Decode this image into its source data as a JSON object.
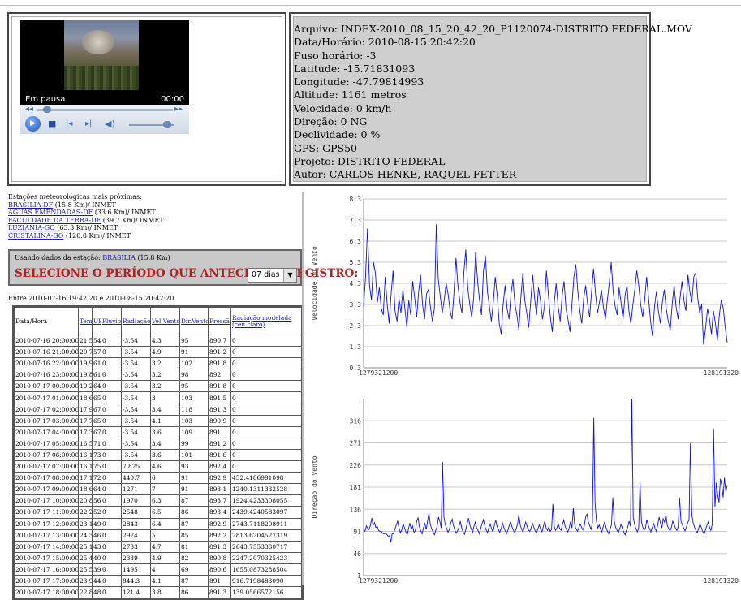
{
  "player": {
    "status": "Em pausa",
    "time": "00:00"
  },
  "info": {
    "lines": [
      "Arquivo: INDEX-2010_08_15_20_42_20_P1120074-DISTRITO FEDERAL.MOV",
      "Data/Horário: 2010-08-15 20:42:20",
      "Fuso horário: -3",
      "Latitude: -15.71831093",
      "Longitude: -47.79814993",
      "Altitude: 1161 metros",
      "Velocidade: 0 km/h",
      "Direção: 0 NG",
      "Declividade: 0 %",
      "GPS: GPS50",
      "Projeto: DISTRITO FEDERAL",
      "Autor: CARLOS HENKE, RAQUEL FETTER"
    ]
  },
  "stations": {
    "title": "Estações meteorológicas mais próximas:",
    "items": [
      {
        "name": "BRASILIA-DF",
        "detail": " (15.8 Km)/ INMET"
      },
      {
        "name": "AGUAS EMENDADAS-DF",
        "detail": " (33.6 Km)/ INMET"
      },
      {
        "name": "FACULDADE DA TERRA-DF",
        "detail": " (39.7 Km)/ INMET"
      },
      {
        "name": "LUZIÂNIA-GO",
        "detail": " (63.3 Km)/ INMET"
      },
      {
        "name": "CRISTALINA-GO",
        "detail": " (120.8 Km)/ INMET"
      }
    ]
  },
  "period": {
    "using_prefix": "Usando dados da estação: ",
    "using_station": "BRASILIA",
    "using_suffix": " (15.8 Km)",
    "select_label": "SELECIONE O PERÍODO QUE ANTECEDE O REGISTRO:",
    "selected": "07 dias"
  },
  "range_text": "Entre 2010-07-16 19:42:20 e 2010-08-15 20:42:20",
  "table": {
    "headers": [
      {
        "text": "Data/Hora",
        "link": false
      },
      {
        "text": "Temp",
        "link": true
      },
      {
        "text": "UR",
        "link": true
      },
      {
        "text": "Pluvio",
        "link": true
      },
      {
        "text": "Radiação",
        "link": true
      },
      {
        "text": "Vel.Vento",
        "link": true
      },
      {
        "text": "Dir.Vento",
        "link": true
      },
      {
        "text": "Pressão",
        "link": true
      },
      {
        "text": "Radiação modelada (céu claro)",
        "link": true
      }
    ],
    "rows": [
      [
        "2010-07-16 20:00:00",
        "21.5",
        "54",
        "0",
        "-3.54",
        "4.3",
        "95",
        "890.7",
        "0"
      ],
      [
        "2010-07-16 21:00:00",
        "20.7",
        "57",
        "0",
        "-3.54",
        "4.9",
        "91",
        "891.2",
        "0"
      ],
      [
        "2010-07-16 22:00:00",
        "19.9",
        "61",
        "0",
        "-3.54",
        "3.2",
        "102",
        "891.8",
        "0"
      ],
      [
        "2010-07-16 23:00:00",
        "19.8",
        "61",
        "0",
        "-3.54",
        "3.2",
        "98",
        "892",
        "0"
      ],
      [
        "2010-07-17 00:00:00",
        "19.2",
        "64",
        "0",
        "-3.54",
        "3.2",
        "95",
        "891.8",
        "0"
      ],
      [
        "2010-07-17 01:00:00",
        "18.6",
        "65",
        "0",
        "-3.54",
        "3",
        "103",
        "891.5",
        "0"
      ],
      [
        "2010-07-17 02:00:00",
        "17.9",
        "67",
        "0",
        "-3.54",
        "3.4",
        "118",
        "891.3",
        "0"
      ],
      [
        "2010-07-17 03:00:00",
        "17.7",
        "65",
        "0",
        "-3.54",
        "4.1",
        "103",
        "890.9",
        "0"
      ],
      [
        "2010-07-17 04:00:00",
        "17.3",
        "67",
        "0",
        "-3.54",
        "3.6",
        "109",
        "891",
        "0"
      ],
      [
        "2010-07-17 05:00:00",
        "16.5",
        "71",
        "0",
        "-3.54",
        "3.4",
        "99",
        "891.2",
        "0"
      ],
      [
        "2010-07-17 06:00:00",
        "16.1",
        "73",
        "0",
        "-3.54",
        "3.6",
        "101",
        "891.6",
        "0"
      ],
      [
        "2010-07-17 07:00:00",
        "16.1",
        "75",
        "0",
        "7.825",
        "4.6",
        "93",
        "892.4",
        "0"
      ],
      [
        "2010-07-17 08:00:00",
        "17.1",
        "72",
        "0",
        "440.7",
        "6",
        "91",
        "892.9",
        "452.4186991098"
      ],
      [
        "2010-07-17 09:00:00",
        "18.6",
        "64",
        "0",
        "1271",
        "7",
        "91",
        "893.1",
        "1240.1311332528"
      ],
      [
        "2010-07-17 10:00:00",
        "20.8",
        "56",
        "0",
        "1970",
        "6.3",
        "87",
        "893.7",
        "1924.4233308055"
      ],
      [
        "2010-07-17 11:00:00",
        "22.2",
        "52",
        "0",
        "2548",
        "6.5",
        "86",
        "893.4",
        "2439.4240583097"
      ],
      [
        "2010-07-17 12:00:00",
        "23.1",
        "49",
        "0",
        "2843",
        "6.4",
        "87",
        "892.9",
        "2743.7118208911"
      ],
      [
        "2010-07-17 13:00:00",
        "24.3",
        "46",
        "0",
        "2974",
        "5",
        "85",
        "892.2",
        "2813.6204527319"
      ],
      [
        "2010-07-17 14:00:00",
        "25.1",
        "43",
        "0",
        "2733",
        "4.7",
        "81",
        "891.3",
        "2643.7553380717"
      ],
      [
        "2010-07-17 15:00:00",
        "25.4",
        "40",
        "0",
        "2339",
        "4.9",
        "82",
        "890.8",
        "2247.2070325423"
      ],
      [
        "2010-07-17 16:00:00",
        "25.5",
        "39",
        "0",
        "1495",
        "4",
        "69",
        "890.6",
        "1655.0873288504"
      ],
      [
        "2010-07-17 17:00:00",
        "23.9",
        "44",
        "0",
        "844.3",
        "4.1",
        "87",
        "891",
        "916.7198483090"
      ],
      [
        "2010-07-17 18:00:00",
        "22.8",
        "48",
        "0",
        "121.4",
        "3.8",
        "86",
        "891.3",
        "139.0566572156"
      ]
    ]
  },
  "chart_data": [
    {
      "type": "line",
      "ylabel": "Velocidade do Vento",
      "xlim": [
        1279321200,
        1281913200
      ],
      "xtick_labels": [
        "1279321200",
        "128191320"
      ],
      "ylim": [
        0.3,
        8.3
      ],
      "yticks": [
        0.3,
        1.3,
        2.3,
        3.3,
        4.3,
        5.3,
        6.3,
        7.3,
        8.3
      ],
      "grid": true,
      "color": "#1010e0",
      "series": [
        {
          "values": [
            3.2,
            4.6,
            6.9,
            4.2,
            3.5,
            5.3,
            4.8,
            3.4,
            4.1,
            3.1,
            2.8,
            4.6,
            3.3,
            2.4,
            3.8,
            4.9,
            3.0,
            2.5,
            3.6,
            2.9,
            4.0,
            3.1,
            2.2,
            3.5,
            2.8,
            4.4,
            3.6,
            2.7,
            3.9,
            4.7,
            3.3,
            2.6,
            3.8,
            4.0,
            3.2,
            2.5,
            3.1,
            7.1,
            4.5,
            3.7,
            2.9,
            3.5,
            4.3,
            3.8,
            3.0,
            2.6,
            3.9,
            5.5,
            4.2,
            3.4,
            2.9,
            4.8,
            5.9,
            4.1,
            3.3,
            2.7,
            3.6,
            5.8,
            4.4,
            3.5,
            2.8,
            4.9,
            5.6,
            3.9,
            3.2,
            2.5,
            3.4,
            4.6,
            3.7,
            2.4,
            1.9,
            3.3,
            4.2,
            3.1,
            2.6,
            3.8,
            4.5,
            3.3,
            2.8,
            2.1,
            3.6,
            4.8,
            3.5,
            2.9,
            2.2,
            3.4,
            4.7,
            3.6,
            2.8,
            4.1,
            3.5,
            2.6,
            3.2,
            4.9,
            3.8,
            2.7,
            2.0,
            3.4,
            4.3,
            3.2,
            2.5,
            3.7,
            4.4,
            3.1,
            2.6,
            2.0,
            3.3,
            4.6,
            5.2,
            3.9,
            3.0,
            2.4,
            3.6,
            4.2,
            3.3,
            2.7,
            3.9,
            5.0,
            3.8,
            2.9,
            3.4,
            4.0,
            3.2,
            2.6,
            3.5,
            4.3,
            5.3,
            3.9,
            3.2,
            2.8,
            4.1,
            3.4,
            2.6,
            3.7,
            4.2,
            3.0,
            2.4,
            3.3,
            4.0,
            4.9,
            4.2,
            3.3,
            2.7,
            3.5,
            4.6,
            3.6,
            2.5,
            1.8,
            3.2,
            3.9,
            3.0,
            2.4,
            3.4,
            4.0,
            3.1,
            2.5,
            2.1,
            3.3,
            4.2,
            3.2,
            2.6,
            3.6,
            4.4,
            3.5,
            3.0,
            4.7,
            3.9,
            3.4,
            4.6,
            4.8,
            3.6,
            2.9,
            3.3,
            1.4,
            2.2,
            3.1,
            2.6,
            1.9,
            3.0,
            2.4,
            1.6,
            2.8,
            3.5,
            3.1,
            2.2,
            1.5
          ]
        }
      ]
    },
    {
      "type": "line",
      "ylabel": "Direção do Vento",
      "xlim": [
        1279321200,
        1281913200
      ],
      "xtick_labels": [
        "1279321200",
        "128191320"
      ],
      "ylim": [
        1,
        361
      ],
      "yticks": [
        1,
        46,
        91,
        136,
        181,
        226,
        271,
        316
      ],
      "grid": true,
      "color": "#1010e0",
      "series": [
        {
          "values": [
            95,
            91,
            102,
            98,
            95,
            103,
            118,
            103,
            109,
            99,
            101,
            93,
            91,
            91,
            87,
            86,
            87,
            85,
            81,
            82,
            69,
            87,
            86,
            96,
            104,
            112,
            98,
            88,
            94,
            106,
            99,
            90,
            84,
            97,
            108,
            95,
            102,
            89,
            93,
            111,
            119,
            100,
            92,
            86,
            99,
            107,
            95,
            113,
            128,
            105,
            96,
            90,
            84,
            93,
            101,
            120,
            111,
            98,
            232,
            120,
            104,
            97,
            89,
            95,
            108,
            116,
            103,
            94,
            87,
            92,
            100,
            112,
            99,
            90,
            85,
            94,
            106,
            118,
            104,
            96,
            89,
            101,
            110,
            98,
            93,
            86,
            97,
            107,
            115,
            102,
            94,
            88,
            99,
            106,
            96,
            90,
            103,
            114,
            101,
            95,
            89,
            97,
            108,
            99,
            92,
            86,
            94,
            103,
            111,
            100,
            93,
            88,
            96,
            105,
            125,
            104,
            96,
            90,
            99,
            110,
            102,
            94,
            91,
            98,
            107,
            100,
            92,
            88,
            97,
            104,
            96,
            90,
            101,
            112,
            99,
            93,
            100,
            91,
            95,
            147,
            100,
            93,
            99,
            106,
            97,
            93,
            105,
            114,
            101,
            95,
            90,
            99,
            111,
            98,
            138,
            104,
            96,
            91,
            98,
            106,
            100,
            94,
            101,
            120,
            126,
            110,
            103,
            95,
            108,
            322,
            150,
            112,
            98,
            104,
            95,
            90,
            101,
            110,
            99,
            92,
            86,
            96,
            104,
            160,
            113,
            100,
            94,
            88,
            96,
            105,
            98,
            90,
            84,
            93,
            100,
            112,
            101,
            364,
            120,
            105,
            96,
            90,
            98,
            190,
            110,
            100,
            93,
            98,
            115,
            104,
            96,
            90,
            99,
            107,
            97,
            91,
            104,
            120,
            108,
            98,
            117,
            110,
            125,
            103,
            97,
            92,
            99,
            112,
            105,
            98,
            93,
            100,
            160,
            112,
            105,
            98,
            92,
            100,
            108,
            115,
            270,
            126,
            108,
            100,
            93,
            88,
            97,
            106,
            99,
            91,
            85,
            94,
            102,
            110,
            100,
            93,
            105,
            300,
            140,
            190,
            165,
            150,
            198,
            185,
            160,
            200,
            172,
            185
          ]
        }
      ]
    }
  ]
}
